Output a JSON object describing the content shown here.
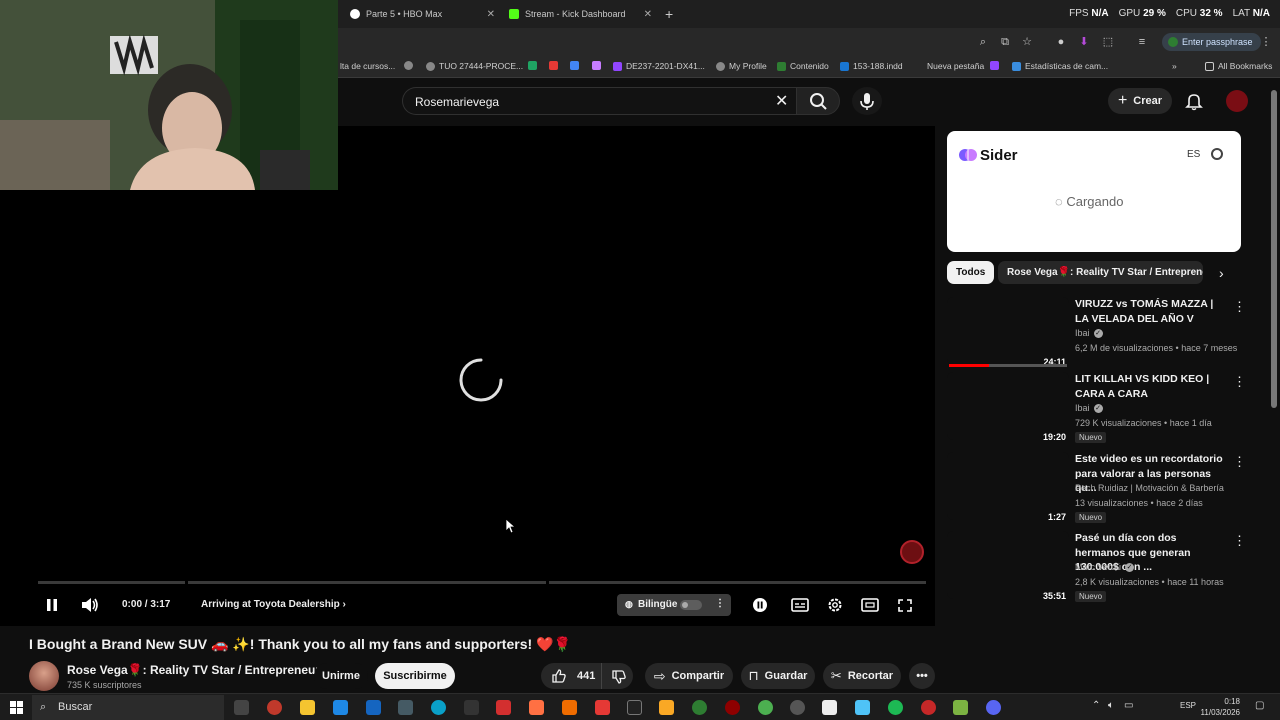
{
  "browser": {
    "tabs": [
      {
        "label": "Parte 5 • HBO Max",
        "color": "#ffffff"
      },
      {
        "label": "Stream - Kick Dashboard",
        "color": "#53fc18"
      }
    ],
    "perf": {
      "fps_label": "FPS",
      "fps": "N/A",
      "gpu_label": "GPU",
      "gpu": "29 %",
      "cpu_label": "CPU",
      "cpu": "32 %",
      "lat_label": "LAT",
      "lat": "N/A"
    },
    "passphrase": "Enter passphrase",
    "bookmarks": [
      "lta de cursos...",
      "TUO 27444-PROCE...",
      "DE237-2201-DX41...",
      "My Profile",
      "Contenido",
      "153-188.indd",
      "Nueva pestaña",
      "Estadísticas de cam...",
      "All Bookmarks"
    ]
  },
  "header": {
    "search_query": "Rosemarievega",
    "create_label": "Crear"
  },
  "player": {
    "time": "0:00 / 3:17",
    "chapter": "Arriving at Toyota Dealership",
    "bilingual": "Bilingüe",
    "progress": 0
  },
  "video": {
    "title": "I Bought a Brand New SUV 🚗 ✨! Thank you to all my fans and supporters! ❤️🌹",
    "channel": "Rose Vega🌹: Reality TV Star / Entrepreneur",
    "subscribers": "735 K suscriptores",
    "join": "Unirme",
    "subscribe": "Suscribirme",
    "likes": "441",
    "share": "Compartir",
    "save": "Guardar",
    "clip": "Recortar"
  },
  "sider": {
    "name": "Sider",
    "lang": "ES",
    "loading": "Cargando"
  },
  "chips": {
    "all": "Todos",
    "channel": "Rose Vega🌹: Reality TV Star / Entrepreneur"
  },
  "recommendations": [
    {
      "title": "VIRUZZ vs TOMÁS MAZZA | LA VELADA DEL AÑO V",
      "channel": "Ibai",
      "verified": true,
      "meta": "6,2 M de visualizaciones • hace 7 meses",
      "duration": "24:11",
      "badge": "",
      "watched": 0.34
    },
    {
      "title": "LIT KILLAH VS KIDD KEO | CARA A CARA",
      "channel": "Ibai",
      "verified": true,
      "meta": "729 K visualizaciones • hace 1 día",
      "duration": "19:20",
      "badge": "Nuevo",
      "watched": 0
    },
    {
      "title": "Este video es un recordatorio para valorar a las personas qu...",
      "channel": "Pech Ruidiaz | Motivación & Barbería",
      "verified": false,
      "meta": "13 visualizaciones • hace 2 días",
      "duration": "1:27",
      "badge": "Nuevo",
      "watched": 0
    },
    {
      "title": "Pasé un día con dos hermanos que generan 130.000$ con ...",
      "channel": "Marc Verdú",
      "verified": true,
      "meta": "2,8 K visualizaciones • hace 11 horas",
      "duration": "35:51",
      "badge": "Nuevo",
      "watched": 0
    }
  ],
  "taskbar": {
    "search": "Buscar",
    "lang": "ESP",
    "time": "0:18",
    "date": "11/03/2026"
  },
  "colors": {
    "background": "#0f0f0f",
    "accent_red": "#ff0000",
    "chip_active": "#f1f1f1"
  }
}
